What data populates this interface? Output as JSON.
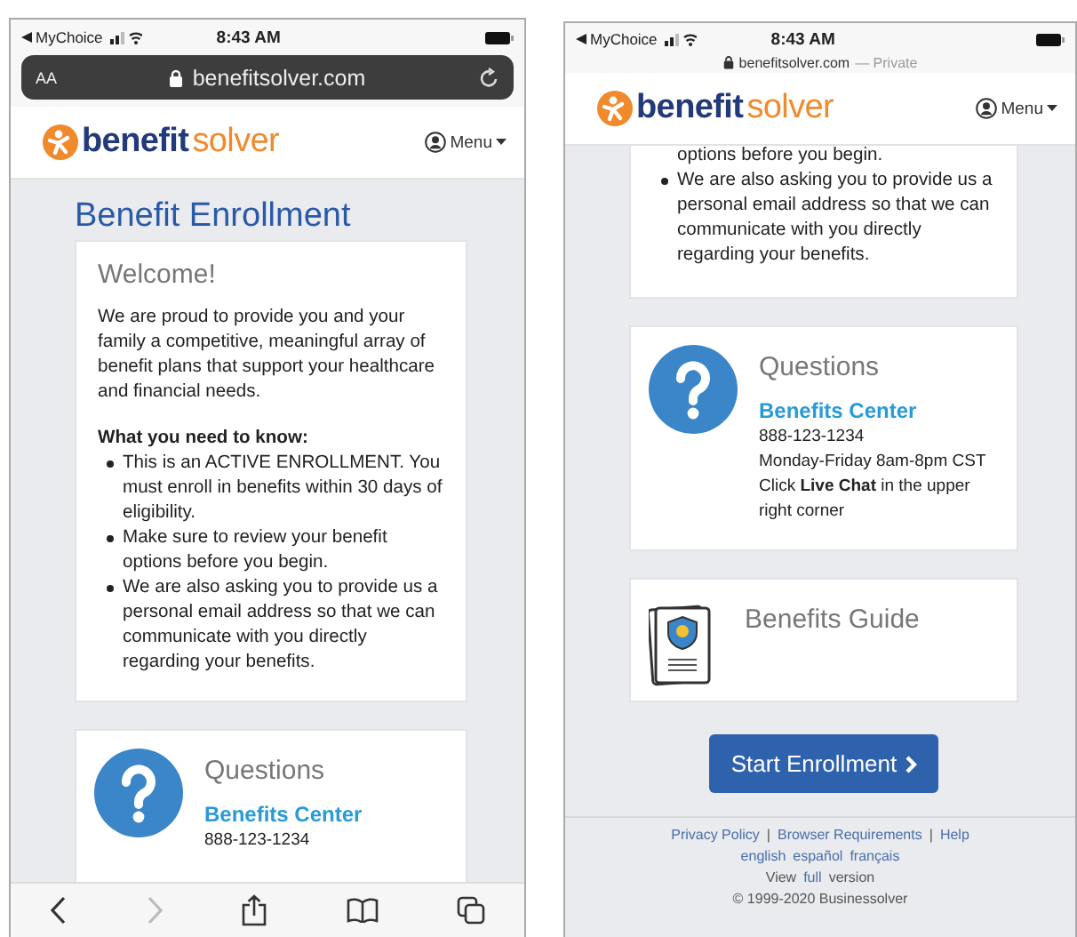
{
  "screens": [
    {
      "status": {
        "carrier": "MyChoice",
        "time": "8:43 AM"
      },
      "address": {
        "kind": "full",
        "text_size": "AA",
        "url": "benefitsolver.com"
      },
      "header": {
        "logo": [
          "benefit",
          "solver"
        ],
        "menu": "Menu"
      },
      "title": "Benefit Enrollment",
      "cards": [
        {
          "kind": "welcome",
          "title": "Welcome!",
          "paragraph": "We are proud to provide you and your family a competitive, meaningful array of benefit plans that support your healthcare and financial needs.",
          "subheading": "What you need to know:",
          "bullets": [
            {
              "text": "This is an ACTIVE ENROLLMENT. You must enroll in benefits within 30 days of eligibility.",
              "bullet": true
            },
            {
              "text": "Make sure to review your benefit options before you begin.",
              "bullet": true
            },
            {
              "text": "We are also asking you to provide us a personal email address so that we can communicate with you directly regarding your benefits.",
              "bullet": true
            }
          ]
        },
        {
          "kind": "contact",
          "title": "Questions",
          "link": "Benefits Center",
          "lines": [
            "888-123-1234"
          ]
        }
      ],
      "toolbar": true
    },
    {
      "status": {
        "carrier": "MyChoice",
        "time": "8:43 AM"
      },
      "address": {
        "kind": "compact",
        "url": "benefitsolver.com",
        "suffix": "— Private"
      },
      "header": {
        "logo": [
          "benefit",
          "solver"
        ],
        "menu": "Menu"
      },
      "cards": [
        {
          "kind": "list",
          "bullets": [
            {
              "text": "options before you begin.",
              "bullet": false
            },
            {
              "text": "We are also asking you to provide us a personal email address so that we can communicate with you directly regarding your benefits.",
              "bullet": true
            }
          ]
        },
        {
          "kind": "contact",
          "title": "Questions",
          "link": "Benefits Center",
          "lines": [
            "888-123-1234",
            "Monday-Friday 8am-8pm CST",
            "Click **Live Chat** in the upper right corner"
          ]
        },
        {
          "kind": "guide",
          "title": "Benefits Guide"
        }
      ],
      "button": "Start Enrollment",
      "footer": {
        "links": [
          "Privacy Policy",
          "Browser Requirements",
          "Help"
        ],
        "separator": "|",
        "languages": [
          "english",
          "español",
          "français"
        ],
        "view": [
          "View",
          "full",
          "version"
        ],
        "copyright": "© 1999-2020 Businessolver"
      },
      "toolbar": false
    }
  ]
}
